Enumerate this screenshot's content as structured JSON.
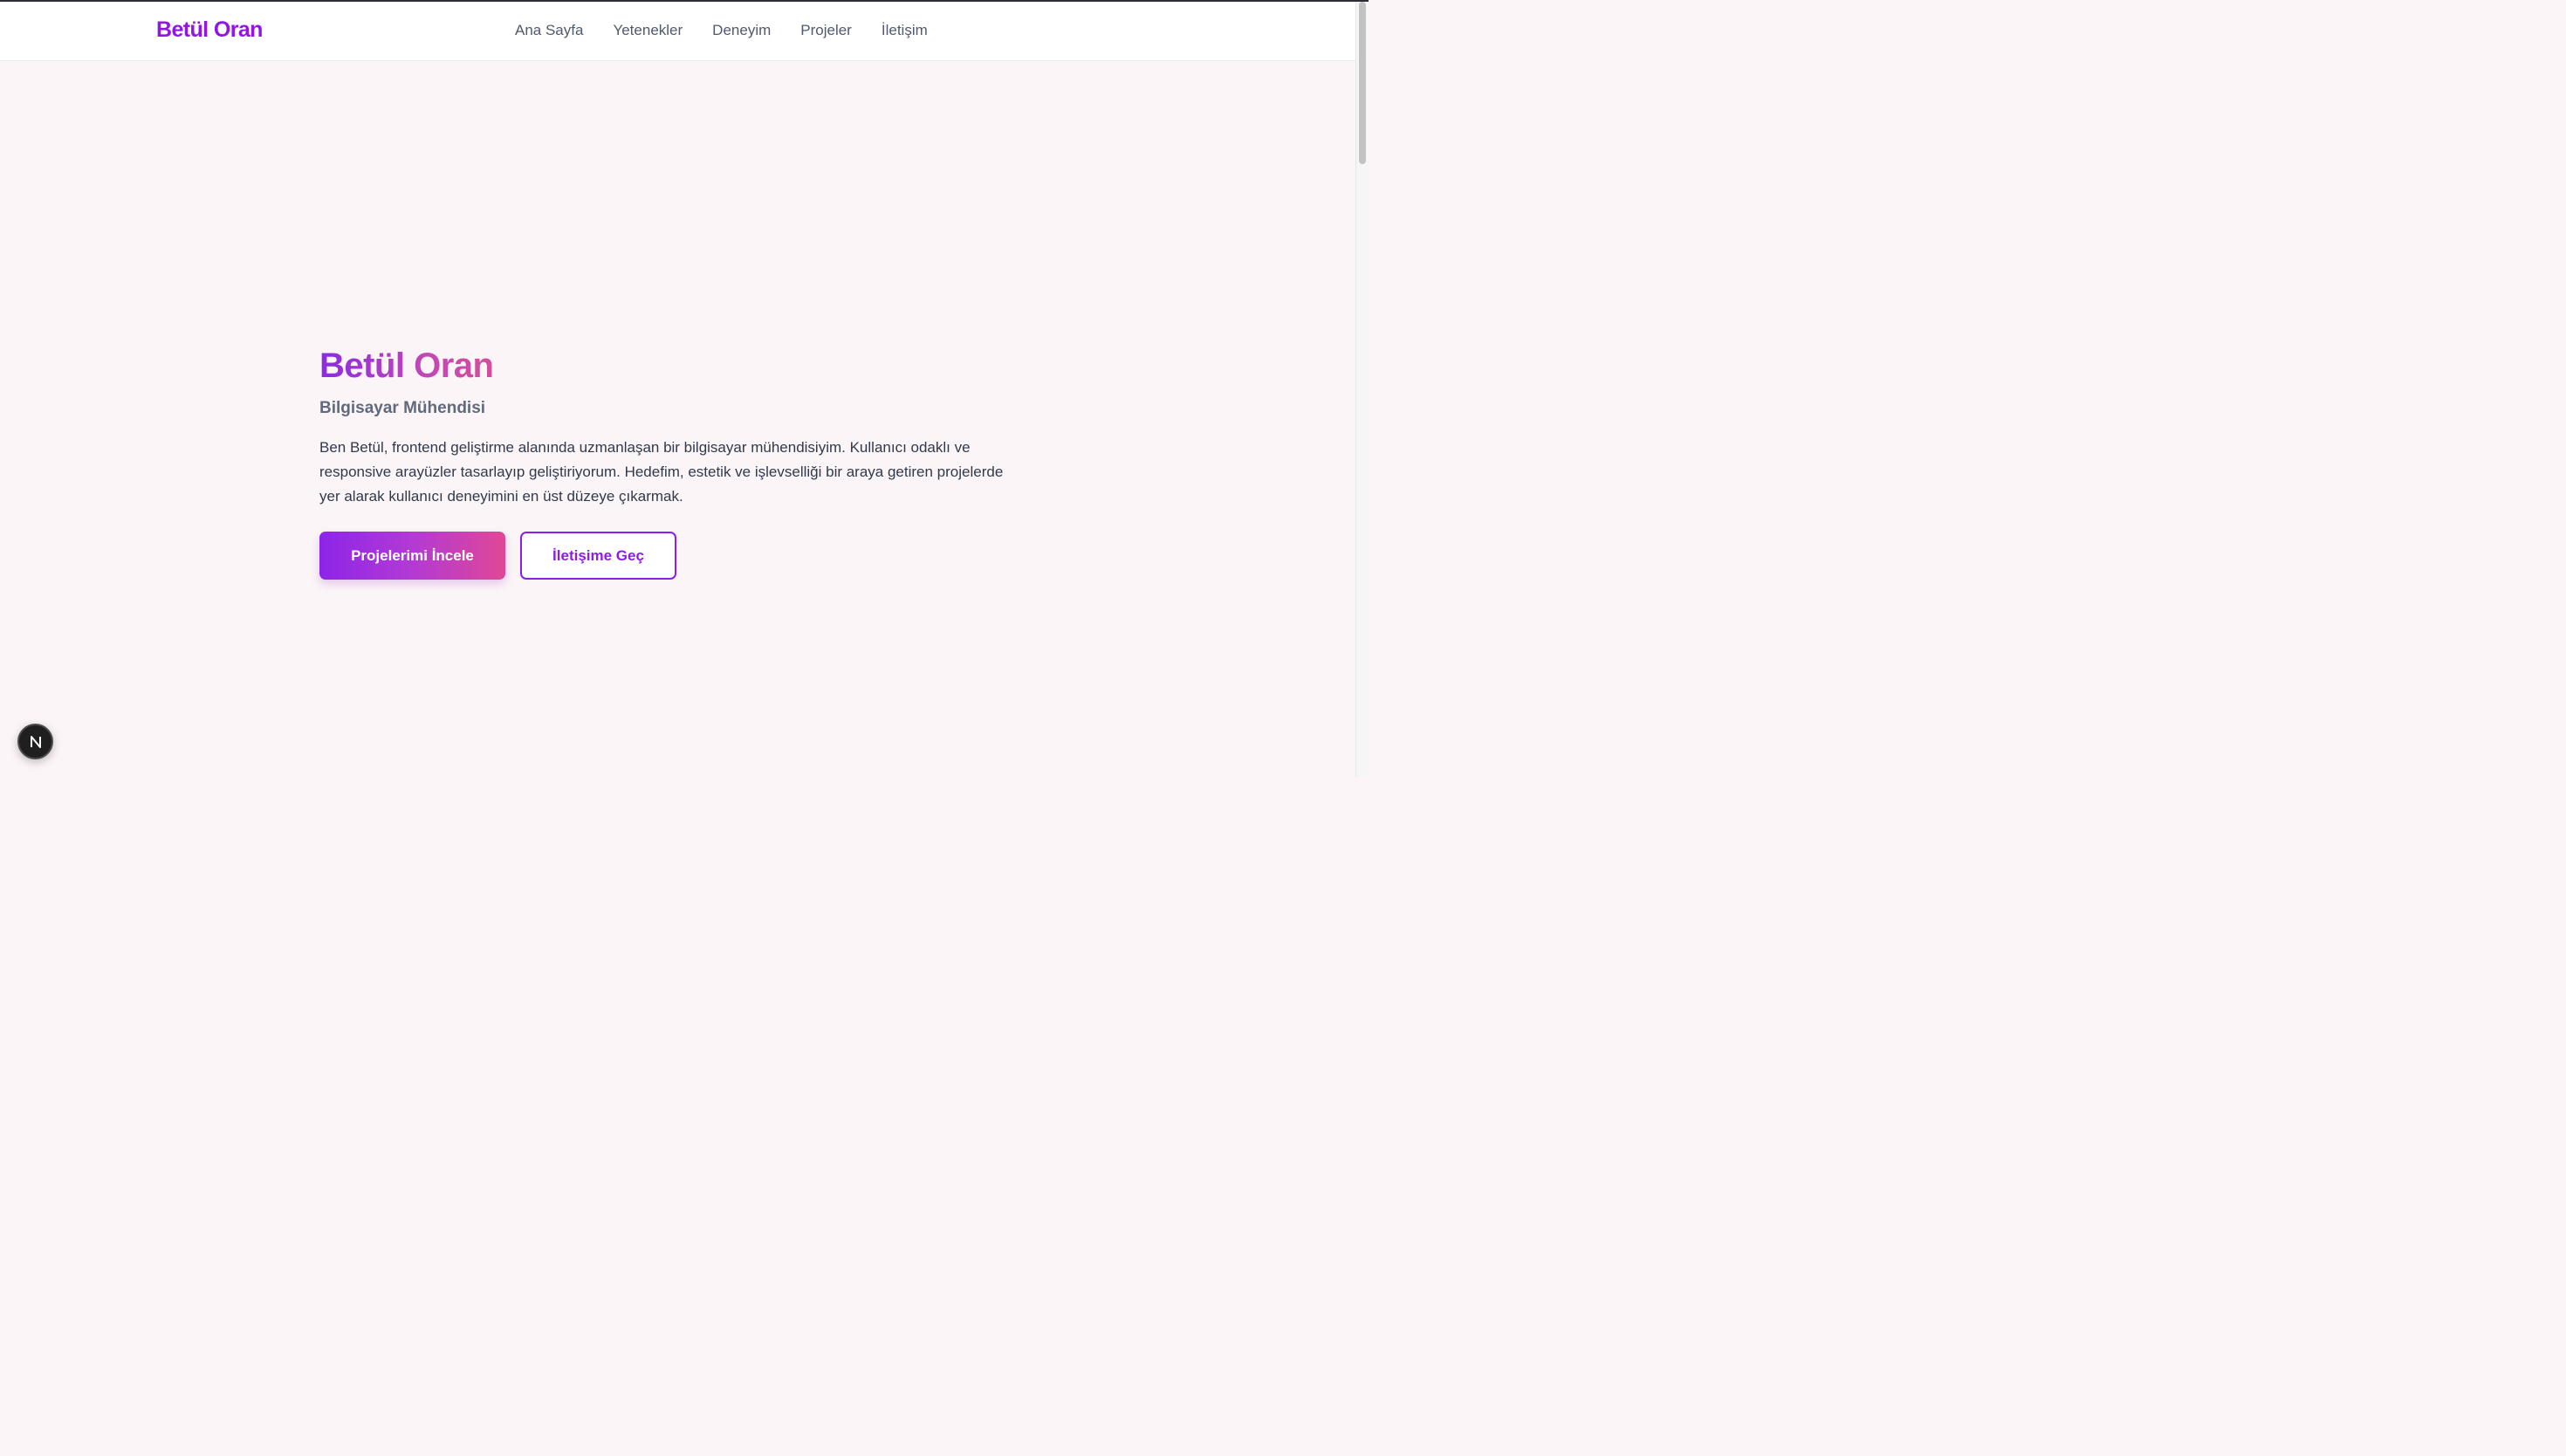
{
  "brand": {
    "name": "Betül Oran"
  },
  "nav": {
    "items": [
      {
        "label": "Ana Sayfa"
      },
      {
        "label": "Yetenekler"
      },
      {
        "label": "Deneyim"
      },
      {
        "label": "Projeler"
      },
      {
        "label": "İletişim"
      }
    ]
  },
  "hero": {
    "name": "Betül Oran",
    "title": "Bilgisayar Mühendisi",
    "description": "Ben Betül, frontend geliştirme alanında uzmanlaşan bir bilgisayar mühendisiyim. Kullanıcı odaklı ve responsive arayüzler tasarlayıp geliştiriyorum. Hedefim, estetik ve işlevselliği bir araya getiren projelerde yer alarak kullanıcı deneyimini en üst düzeye çıkarmak.",
    "primary_button": "Projelerimi İncele",
    "secondary_button": "İletişime Geç"
  },
  "badge": {
    "icon": "nextjs-n-icon"
  },
  "colors": {
    "accent": "#9016e8",
    "gradient_end": "#e04796",
    "background": "#fbf5f7",
    "nav_text": "#4f5a6e"
  }
}
